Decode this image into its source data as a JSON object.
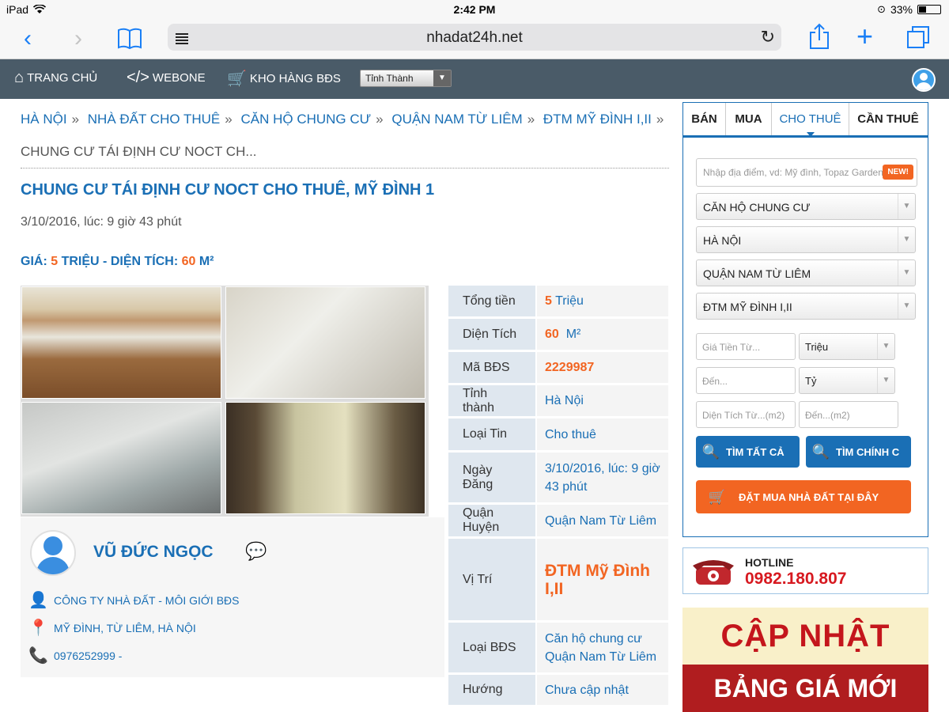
{
  "status_bar": {
    "device": "iPad",
    "time": "2:42 PM",
    "battery": "33%",
    "battery_level": 0.33
  },
  "browser": {
    "url": "nhadat24h.net"
  },
  "nav": {
    "home": "TRANG CHỦ",
    "webone": "WEBONE",
    "store": "KHO HÀNG BĐS",
    "province_select": "Tỉnh Thành"
  },
  "breadcrumb": {
    "items": [
      "HÀ NỘI",
      "NHÀ ĐẤT CHO THUÊ",
      "CĂN HỘ CHUNG CƯ",
      "QUẬN NAM TỪ LIÊM",
      "ĐTM MỸ ĐÌNH I,II"
    ],
    "separator": "»",
    "current": "CHUNG CƯ TÁI ĐỊNH CƯ NOCT CH..."
  },
  "post": {
    "title": "CHUNG CƯ TÁI ĐỊNH CƯ NOCT CHO THUÊ, MỸ ĐÌNH 1",
    "date": "3/10/2016, lúc: 9 giờ 43 phút",
    "price_label": "GIÁ:",
    "price_value": "5",
    "price_unit": "TRIỆU",
    "area_label": "DIỆN TÍCH:",
    "area_value": "60",
    "area_unit": "M²"
  },
  "agent": {
    "name": "VŨ ĐỨC NGỌC",
    "company": "CÔNG TY NHÀ ĐẤT - MÔI GIỚI BĐS",
    "location": "MỸ ĐÌNH, TỪ LIÊM, HÀ NỘI",
    "phone": "0976252999 -"
  },
  "info": {
    "rows": [
      {
        "key": "Tổng tiền",
        "val_a": "5",
        "val_b": " Triệu"
      },
      {
        "key": "Diện Tích",
        "val_a": "60",
        "val_b": "  M²"
      },
      {
        "key": "Mã BĐS",
        "val_a": "2229987",
        "val_b": ""
      },
      {
        "key": "Tỉnh thành",
        "val_a": "Hà Nội",
        "val_b": ""
      },
      {
        "key": "Loại Tin",
        "val_a": "Cho thuê",
        "val_b": ""
      },
      {
        "key": "Ngày Đăng",
        "val_a": "3/10/2016, lúc: 9 giờ 43 phút",
        "val_b": ""
      },
      {
        "key": "Quận Huyện",
        "val_a": "Quận Nam Từ Liêm",
        "val_b": ""
      },
      {
        "key": "Vị Trí",
        "val_a": "ĐTM Mỹ Đình I,II",
        "val_b": ""
      },
      {
        "key": "Loại BĐS",
        "val_a": "Căn hộ chung cư Quận Nam Từ Liêm",
        "val_b": ""
      },
      {
        "key": "Hướng",
        "val_a": "Chưa cập nhật",
        "val_b": ""
      }
    ]
  },
  "search": {
    "tabs": [
      "BÁN",
      "MUA",
      "CHO THUÊ",
      "CẦN THUÊ"
    ],
    "location_placeholder": "Nhập địa điểm, vd: Mỹ đình, Topaz Garden",
    "new_badge": "NEW!",
    "type": "CĂN HỘ CHUNG CƯ",
    "city": "HÀ NỘI",
    "district": "QUẬN NAM TỪ LIÊM",
    "area": "ĐTM MỸ ĐÌNH I,II",
    "price_from_placeholder": "Giá Tiền Từ...",
    "price_from_unit": "Triệu",
    "price_to_placeholder": "Đến...",
    "price_to_unit": "Tỷ",
    "size_from_placeholder": "Diện Tích Từ...(m2)",
    "size_to_placeholder": "Đến...(m2)",
    "btn_all": "TÌM TẤT CẢ",
    "btn_main": "TÌM CHÍNH C",
    "btn_buy": "ĐẶT MUA NHÀ ĐẤT TẠI ĐÂY"
  },
  "hotline": {
    "label": "HOTLINE",
    "number": "0982.180.807"
  },
  "banner": {
    "line1": "CẬP NHẬT",
    "line2": "BẢNG GIÁ MỚI NHẤT"
  }
}
